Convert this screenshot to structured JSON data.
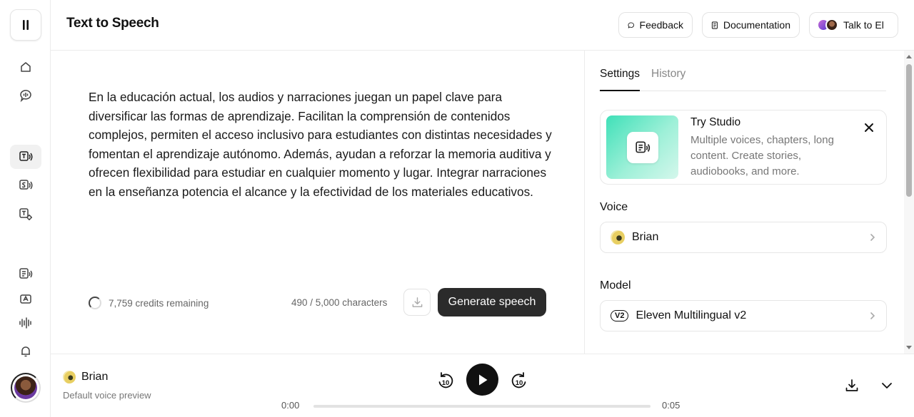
{
  "header": {
    "title": "Text to Speech",
    "feedback_label": "Feedback",
    "documentation_label": "Documentation",
    "talk_label": "Talk to El"
  },
  "sidebar": {
    "items": [
      {
        "name": "home-icon"
      },
      {
        "name": "voices-icon"
      },
      {
        "name": "text-to-speech-icon",
        "active": true
      },
      {
        "name": "speech-to-speech-icon"
      },
      {
        "name": "sound-effects-icon"
      },
      {
        "name": "studio-icon"
      },
      {
        "name": "dubbing-icon"
      },
      {
        "name": "audio-waveform-icon"
      },
      {
        "name": "notifications-bell-icon"
      }
    ]
  },
  "editor": {
    "text": "En la educación actual, los audios y narraciones juegan un papel clave para diversificar las formas de aprendizaje. Facilitan la comprensión de contenidos complejos, permiten el acceso inclusivo para estudiantes con distintas necesidades y fomentan el aprendizaje autónomo. Además, ayudan a reforzar la memoria auditiva y ofrecen flexibilidad para estudiar en cualquier momento y lugar. Integrar narraciones en la enseñanza potencia el alcance y la efectividad de los materiales educativos.",
    "credits": "7,759 credits remaining",
    "char_count": "490 / 5,000 characters",
    "generate_label": "Generate speech"
  },
  "settings": {
    "tabs": [
      {
        "label": "Settings",
        "active": true
      },
      {
        "label": "History",
        "active": false
      }
    ],
    "promo": {
      "title": "Try Studio",
      "description": "Multiple voices, chapters, long content. Create stories, audiobooks, and more."
    },
    "voice_label": "Voice",
    "voice_value": "Brian",
    "model_label": "Model",
    "model_badge": "V2",
    "model_value": "Eleven Multilingual v2"
  },
  "player": {
    "voice_name": "Brian",
    "subtitle": "Default voice preview",
    "skip_back_label": "10",
    "skip_forward_label": "10",
    "current_time": "0:00",
    "total_time": "0:05",
    "progress_fraction": 0
  },
  "colors": {
    "primary_button": "#2b2b2b",
    "promo_gradient_start": "#3fe0b8",
    "promo_gradient_end": "#d5f7ec"
  }
}
